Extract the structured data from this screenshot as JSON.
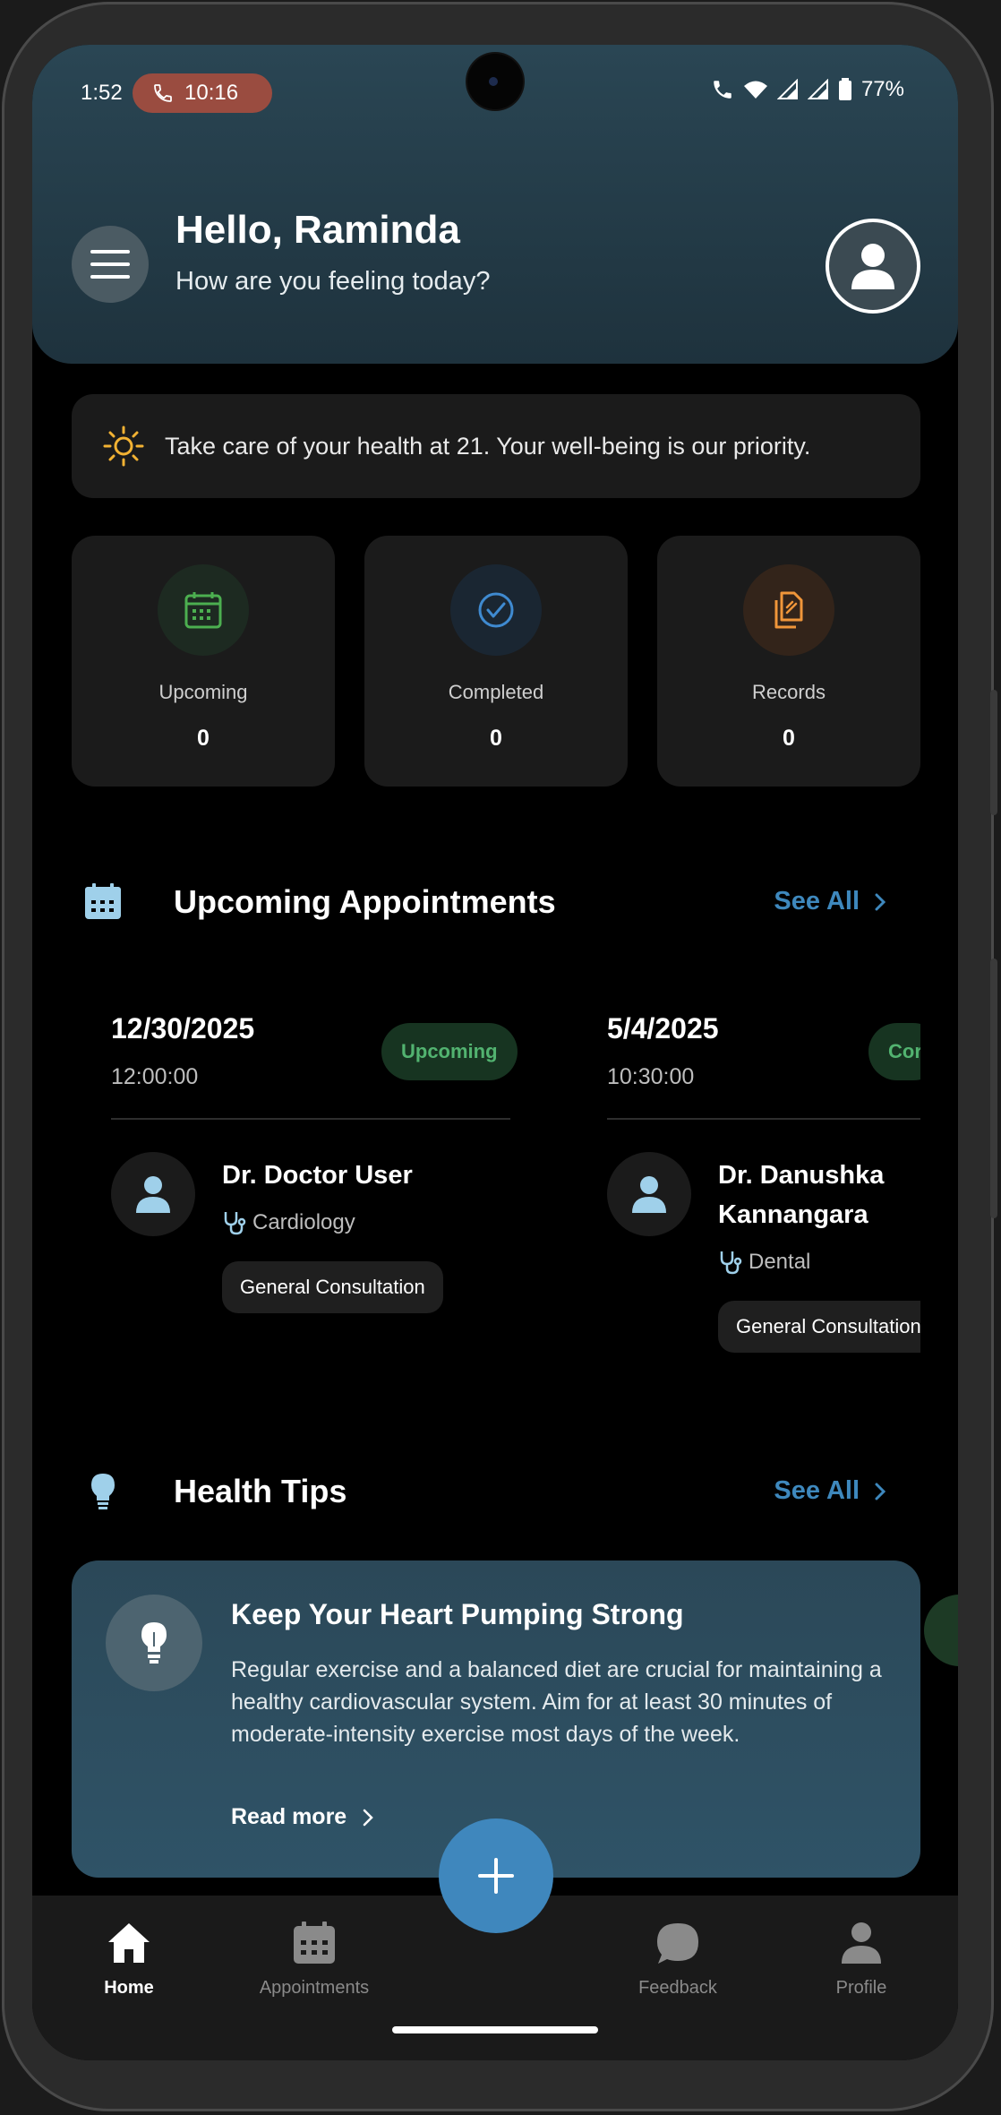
{
  "status_bar": {
    "time": "1:52",
    "call_time": "10:16",
    "battery": "77%"
  },
  "header": {
    "greeting": "Hello, Raminda",
    "subtitle": "How are you feeling today?"
  },
  "tip_banner": {
    "text": "Take care of your health at 21. Your well-being is our priority."
  },
  "stats": [
    {
      "label": "Upcoming",
      "value": "0",
      "color": "#4caf50"
    },
    {
      "label": "Completed",
      "value": "0",
      "color": "#3f8ad0"
    },
    {
      "label": "Records",
      "value": "0",
      "color": "#f0963a"
    }
  ],
  "appointments_section": {
    "title": "Upcoming Appointments",
    "see_all": "See All"
  },
  "appointments": [
    {
      "date": "12/30/2025",
      "time": "12:00:00",
      "status": "Upcoming",
      "doctor": "Dr. Doctor User",
      "specialty": "Cardiology",
      "type": "General Consultation"
    },
    {
      "date": "5/4/2025",
      "time": "10:30:00",
      "status": "Cor",
      "doctor": "Dr. Danushka Kannangara",
      "specialty": "Dental",
      "type": "General Consultation"
    }
  ],
  "health_section": {
    "title": "Health Tips",
    "see_all": "See All"
  },
  "health_tip": {
    "title": "Keep Your Heart Pumping Strong",
    "body": "Regular exercise and a balanced diet are crucial for maintaining a healthy cardiovascular system.  Aim for at least 30 minutes of moderate-intensity exercise most days of the week.",
    "read_more": "Read more"
  },
  "bottom_nav": [
    {
      "label": "Home",
      "icon": "home-icon",
      "active": true
    },
    {
      "label": "Appointments",
      "icon": "calendar-icon",
      "active": false
    },
    {
      "label": "Feedback",
      "icon": "chat-icon",
      "active": false
    },
    {
      "label": "Profile",
      "icon": "person-icon",
      "active": false
    }
  ],
  "colors": {
    "accent": "#3f87bd",
    "header_bg": "#2a4654",
    "card_bg": "#1b1b1b"
  }
}
